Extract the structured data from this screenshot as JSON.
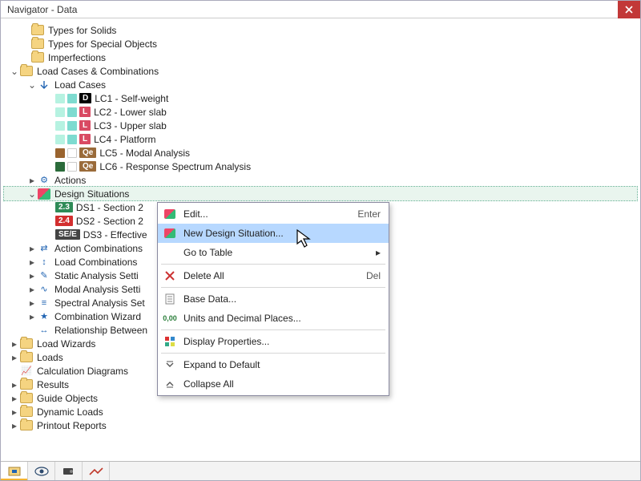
{
  "window": {
    "title": "Navigator - Data"
  },
  "tree": {
    "types_solids": "Types for Solids",
    "types_special": "Types for Special Objects",
    "imperfections": "Imperfections",
    "lcc": "Load Cases & Combinations",
    "load_cases": "Load Cases",
    "lc1": {
      "badge": "D",
      "label": "LC1 - Self-weight"
    },
    "lc2": {
      "badge": "L",
      "label": "LC2 - Lower slab"
    },
    "lc3": {
      "badge": "L",
      "label": "LC3 - Upper slab"
    },
    "lc4": {
      "badge": "L",
      "label": "LC4 - Platform"
    },
    "lc5": {
      "badge": "Qe",
      "label": "LC5 - Modal Analysis"
    },
    "lc6": {
      "badge": "Qe",
      "label": "LC6 - Response Spectrum Analysis"
    },
    "actions": "Actions",
    "design_situations": "Design Situations",
    "ds1": {
      "badge": "2.3",
      "label": "DS1 - Section 2"
    },
    "ds2": {
      "badge": "2.4",
      "label": "DS2 - Section 2"
    },
    "ds3": {
      "badge": "SE/E",
      "label": "DS3 - Effective"
    },
    "action_comb": "Action Combinations",
    "load_comb": "Load Combinations",
    "static_settings": "Static Analysis Setti",
    "modal_settings": "Modal Analysis Setti",
    "spectral_settings": "Spectral Analysis Set",
    "comb_wizard": "Combination Wizard",
    "rel_between": "Relationship Between",
    "load_wizards": "Load Wizards",
    "loads": "Loads",
    "calc_diagrams": "Calculation Diagrams",
    "results": "Results",
    "guide_objects": "Guide Objects",
    "dynamic_loads": "Dynamic Loads",
    "printout_reports": "Printout Reports"
  },
  "context_menu": {
    "edit": {
      "label": "Edit...",
      "accel": "Enter"
    },
    "new_ds": {
      "label": "New Design Situation..."
    },
    "go_to_table": {
      "label": "Go to Table"
    },
    "delete_all": {
      "label": "Delete All",
      "accel": "Del"
    },
    "base_data": {
      "label": "Base Data..."
    },
    "units": {
      "label": "Units and Decimal Places..."
    },
    "disp_props": {
      "label": "Display Properties..."
    },
    "expand": {
      "label": "Expand to Default"
    },
    "collapse": {
      "label": "Collapse All"
    }
  }
}
